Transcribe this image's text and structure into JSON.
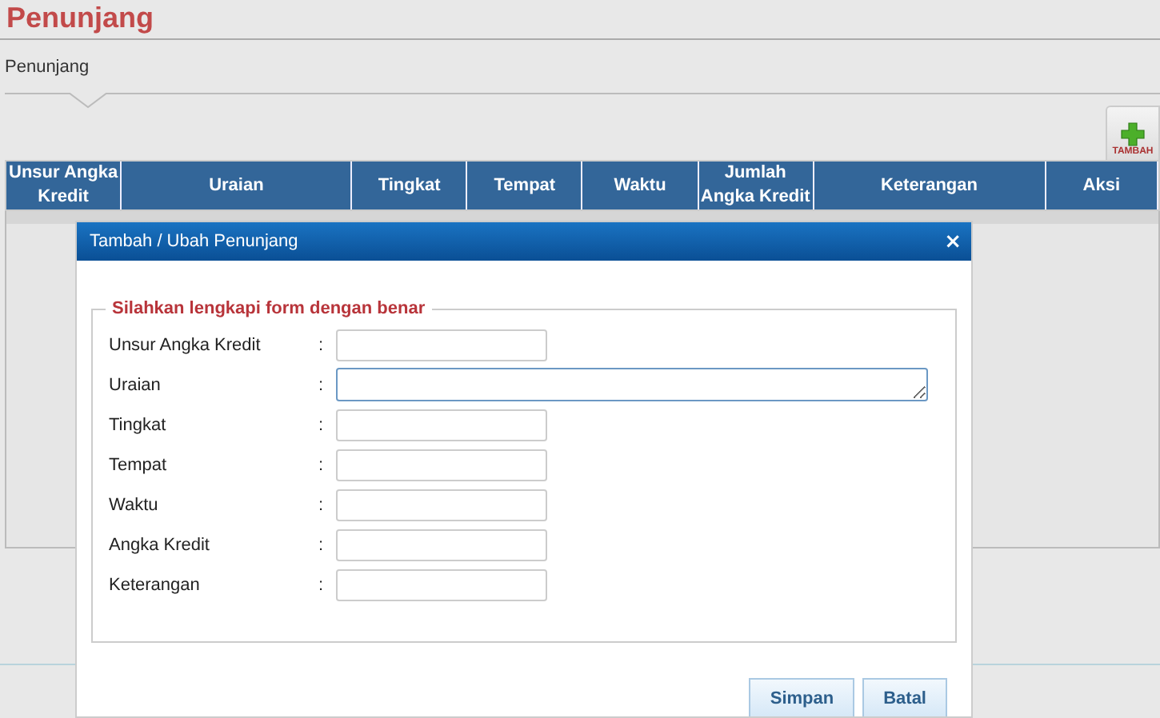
{
  "page": {
    "title": "Penunjang",
    "breadcrumb": "Penunjang"
  },
  "toolbar": {
    "add_button": "TAMBAH"
  },
  "table": {
    "columns": [
      "Unsur Angka Kredit",
      "Uraian",
      "Tingkat",
      "Tempat",
      "Waktu",
      "Jumlah Angka Kredit",
      "Keterangan",
      "Aksi"
    ]
  },
  "dialog": {
    "title": "Tambah / Ubah Penunjang",
    "close": "×",
    "legend": "Silahkan lengkapi form dengan benar",
    "fields": [
      {
        "label": "Unsur Angka Kredit",
        "separator": ":",
        "kind": "text"
      },
      {
        "label": "Uraian",
        "separator": ":",
        "kind": "textarea"
      },
      {
        "label": "Tingkat",
        "separator": ":",
        "kind": "text"
      },
      {
        "label": "Tempat",
        "separator": ":",
        "kind": "text"
      },
      {
        "label": "Waktu",
        "separator": ":",
        "kind": "text"
      },
      {
        "label": "Angka Kredit",
        "separator": ":",
        "kind": "text"
      },
      {
        "label": "Keterangan",
        "separator": ":",
        "kind": "text"
      }
    ],
    "buttons": [
      "Simpan",
      "Batal"
    ]
  }
}
